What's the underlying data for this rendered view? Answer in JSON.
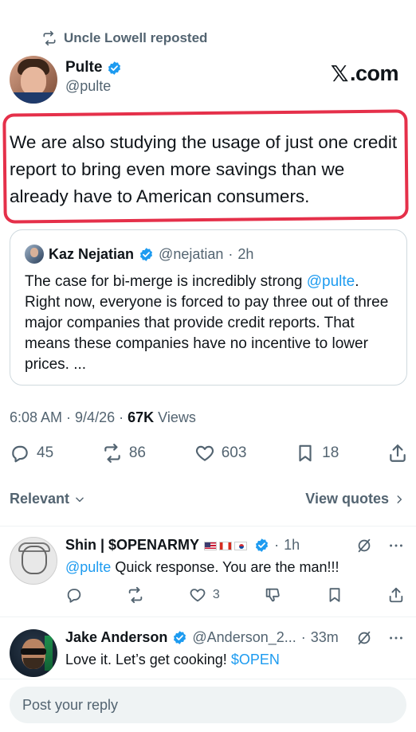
{
  "repost": {
    "text": "Uncle Lowell reposted",
    "icon": "repost-icon"
  },
  "author": {
    "name": "Pulte",
    "handle": "@pulte",
    "verified": true
  },
  "brand": {
    "text": ".com"
  },
  "tweet": {
    "text": "We are also studying the usage of just one credit report to bring even more savings than we already have to American consumers.",
    "highlight_color": "#e5304a"
  },
  "quote": {
    "name": "Kaz Nejatian",
    "handle": "@nejatian",
    "time": "2h",
    "text_before": "The case for bi-merge is incredibly strong ",
    "mention": "@pulte",
    "text_after": ". Right now, everyone is forced to pay three out of three major companies that provide credit reports. That means these companies have no incentive to lower prices.  ..."
  },
  "meta": {
    "time": "6:08 AM",
    "date": "9/4/26",
    "views_count": "67K",
    "views_label": "Views"
  },
  "actions": {
    "replies": "45",
    "reposts": "86",
    "likes": "603",
    "bookmarks": "18"
  },
  "sort": {
    "relevant": "Relevant",
    "view_quotes": "View quotes"
  },
  "replies": [
    {
      "name": "Shin | $OPENARMY",
      "time": "1h",
      "mention": "@pulte",
      "text": " Quick response. You are the man!!!",
      "likes": "3"
    },
    {
      "name": "Jake Anderson",
      "handle": "@Anderson_2...",
      "time": "33m",
      "text": "Love it. Let’s get cooking! ",
      "cashtag": "$OPEN"
    }
  ],
  "composer": {
    "placeholder": "Post your reply"
  },
  "colors": {
    "accent": "#1d9bf0",
    "muted": "#536471",
    "text": "#0f1419",
    "highlight": "#e5304a"
  }
}
